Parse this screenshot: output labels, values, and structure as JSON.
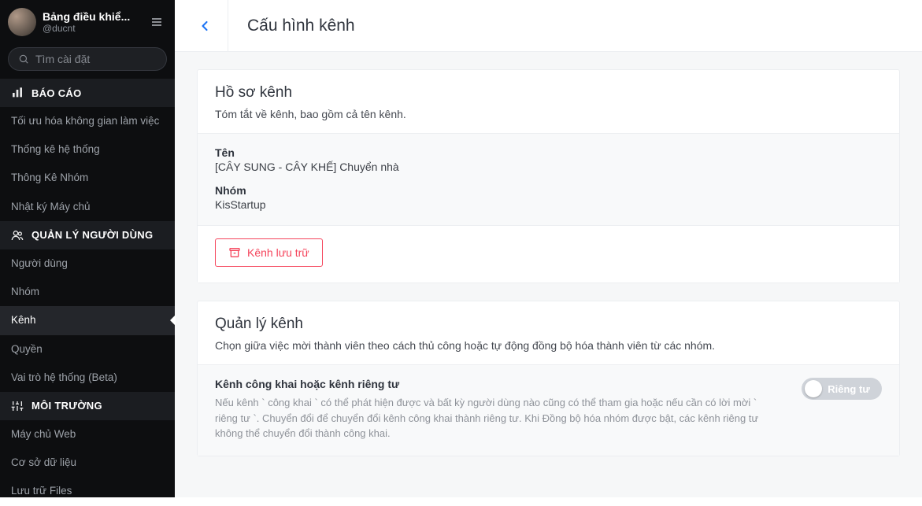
{
  "sidebar": {
    "title": "Bảng điều khiể...",
    "handle": "@ducnt",
    "search_placeholder": "Tìm cài đặt",
    "sections": [
      {
        "title": "BÁO CÁO",
        "icon": "bar-chart-icon",
        "items": [
          {
            "label": "Tối ưu hóa không gian làm việc"
          },
          {
            "label": "Thống kê hệ thống"
          },
          {
            "label": "Thông Kê Nhóm"
          },
          {
            "label": "Nhật ký Máy chủ"
          }
        ]
      },
      {
        "title": "QUẢN LÝ NGƯỜI DÙNG",
        "icon": "users-icon",
        "items": [
          {
            "label": "Người dùng"
          },
          {
            "label": "Nhóm"
          },
          {
            "label": "Kênh",
            "active": true
          },
          {
            "label": "Quyền"
          },
          {
            "label": "Vai trò hệ thống (Beta)"
          }
        ]
      },
      {
        "title": "MÔI TRƯỜNG",
        "icon": "sliders-icon",
        "items": [
          {
            "label": "Máy chủ Web"
          },
          {
            "label": "Cơ sở dữ liệu"
          },
          {
            "label": "Lưu trữ Files"
          }
        ]
      }
    ]
  },
  "page": {
    "title": "Cấu hình kênh"
  },
  "profile_card": {
    "title": "Hồ sơ kênh",
    "subtitle": "Tóm tắt về kênh, bao gồm cả tên kênh.",
    "name_label": "Tên",
    "name_value": "[CÂY SUNG - CÂY KHẾ] Chuyển nhà",
    "group_label": "Nhóm",
    "group_value": "KisStartup",
    "archive_button": "Kênh lưu trữ"
  },
  "manage_card": {
    "title": "Quản lý kênh",
    "subtitle": "Chọn giữa việc mời thành viên theo cách thủ công hoặc tự động đồng bộ hóa thành viên từ các nhóm.",
    "privacy_toggle_title": "Kênh công khai hoặc kênh riêng tư",
    "privacy_toggle_desc": "Nếu kênh ` công khai ` có thể phát hiện được và bất kỳ người dùng nào cũng có thể tham gia hoặc nếu cần có lời mời ` riêng tư `. Chuyển đổi để chuyển đổi kênh công khai thành riêng tư. Khi Đồng bộ hóa nhóm được bật, các kênh riêng tư không thể chuyển đổi thành công khai.",
    "privacy_toggle_state": "Riêng tư"
  }
}
